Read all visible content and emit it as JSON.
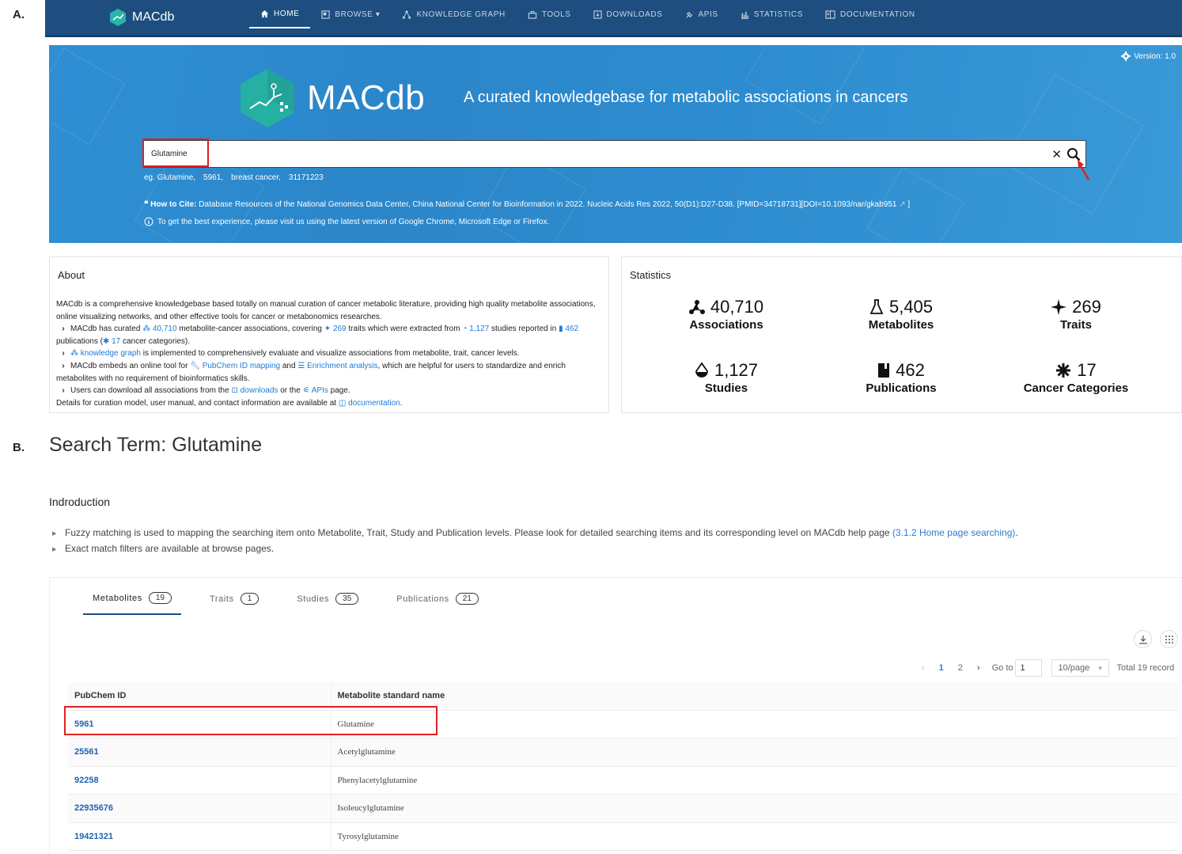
{
  "panel_labels": {
    "a": "A.",
    "b": "B."
  },
  "nav": {
    "brand": "MACdb",
    "items": [
      {
        "label": "HOME",
        "icon": "home-icon",
        "active": true
      },
      {
        "label": "BROWSE ▾",
        "icon": "browse-icon"
      },
      {
        "label": "KNOWLEDGE GRAPH",
        "icon": "graph-icon"
      },
      {
        "label": "TOOLS",
        "icon": "toolbox-icon"
      },
      {
        "label": "DOWNLOADS",
        "icon": "download-icon"
      },
      {
        "label": "APIS",
        "icon": "api-icon"
      },
      {
        "label": "STATISTICS",
        "icon": "bar-chart-icon"
      },
      {
        "label": "DOCUMENTATION",
        "icon": "book-icon"
      }
    ]
  },
  "hero": {
    "brand": "MACdb",
    "tagline": "A curated knowledgebase for metabolic associations in cancers",
    "version": "Version: 1.0",
    "search_value": "Glutamine",
    "examples": [
      "eg. Glutamine,",
      "5961,",
      "breast cancer,",
      "31171223"
    ],
    "cite_label": "How to Cite:",
    "cite_text": "Database Resources of the National Genomics Data Center, China National Center for Bioinformation in 2022. Nucleic Acids Res 2022, 50(D1):D27-D38. [PMID=34718731][DOI=10.1093/nar/gkab951",
    "cite_end": "]",
    "browser_note": "To get the best experience, please visit us using the latest version of Google Chrome, Microsoft Edge or Firefox."
  },
  "about": {
    "title": "About",
    "intro": "MACdb is a comprehensive knowledgebase based totally on manual curation of cancer metabolic literature, providing high quality metabolite associations, online visualizing networks, and other effective tools for cancer or metabonomics researches.",
    "b1_a": "MACdb has curated",
    "b1_assoc": "40,710",
    "b1_b": "metabolite-cancer associations, covering",
    "b1_traits": "269",
    "b1_c": "traits which were extracted from",
    "b1_studies": "1,127",
    "b1_d": "studies reported in",
    "b1_pubs": "462",
    "b1_e": "publications (",
    "b1_cats": "17",
    "b1_f": "cancer categories).",
    "b2_link": "knowledge graph",
    "b2_text": "is implemented to comprehensively evaluate and visualize associations from metabolite, trait, cancer levels.",
    "b3_a": "MACdb embeds an online tool for",
    "b3_link1": "PubChem ID mapping",
    "b3_b": "and",
    "b3_link2": "Enrichment analysis",
    "b3_c": ", which are helpful for users to standardize and enrich metabolites with no requirement of bioinformatics skills.",
    "b4_a": "Users can download all associations from the",
    "b4_link1": "downloads",
    "b4_b": "or the",
    "b4_link2": "APIs",
    "b4_c": "page.",
    "footer_a": "Details for curation model, user manual, and contact information are available at",
    "footer_link": "documentation",
    "footer_b": "."
  },
  "stats": {
    "title": "Statistics",
    "items": [
      {
        "value": "40,710",
        "label": "Associations",
        "icon": "network-icon"
      },
      {
        "value": "5,405",
        "label": "Metabolites",
        "icon": "flask-icon"
      },
      {
        "value": "269",
        "label": "Traits",
        "icon": "star-icon"
      },
      {
        "value": "1,127",
        "label": "Studies",
        "icon": "drop-icon"
      },
      {
        "value": "462",
        "label": "Publications",
        "icon": "book-icon"
      },
      {
        "value": "17",
        "label": "Cancer Categories",
        "icon": "splat-icon"
      }
    ]
  },
  "search_page": {
    "title": "Search Term: Glutamine",
    "intro_title": "Indroduction",
    "intro_1": "Fuzzy matching is used to mapping the searching item onto Metabolite, Trait, Study and Publication levels. Please look for detailed searching items and its corresponding level on MACdb help page",
    "intro_1_link": "(3.1.2 Home page searching)",
    "intro_1_end": ".",
    "intro_2": "Exact match filters are available at browse pages.",
    "tabs": [
      {
        "label": "Metabolites",
        "count": "19",
        "active": true
      },
      {
        "label": "Traits",
        "count": "1"
      },
      {
        "label": "Studies",
        "count": "35"
      },
      {
        "label": "Publications",
        "count": "21"
      }
    ],
    "pager": {
      "pages": [
        "1",
        "2"
      ],
      "goto_label": "Go to",
      "goto_value": "1",
      "page_size": "10/page",
      "total": "Total 19 record"
    },
    "columns": [
      "PubChem ID",
      "Metabolite standard name"
    ],
    "rows": [
      [
        "5961",
        "Glutamine"
      ],
      [
        "25561",
        "Acetylglutamine"
      ],
      [
        "92258",
        "Phenylacetylglutamine"
      ],
      [
        "22935676",
        "Isoleucylglutamine"
      ],
      [
        "19421321",
        "Tyrosylglutamine"
      ]
    ]
  }
}
